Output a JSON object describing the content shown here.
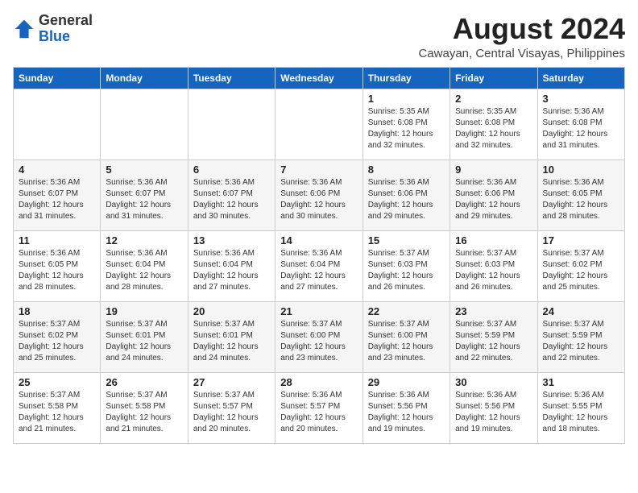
{
  "header": {
    "logo_general": "General",
    "logo_blue": "Blue",
    "month_year": "August 2024",
    "location": "Cawayan, Central Visayas, Philippines"
  },
  "days_of_week": [
    "Sunday",
    "Monday",
    "Tuesday",
    "Wednesday",
    "Thursday",
    "Friday",
    "Saturday"
  ],
  "weeks": [
    [
      {
        "day": "",
        "info": ""
      },
      {
        "day": "",
        "info": ""
      },
      {
        "day": "",
        "info": ""
      },
      {
        "day": "",
        "info": ""
      },
      {
        "day": "1",
        "info": "Sunrise: 5:35 AM\nSunset: 6:08 PM\nDaylight: 12 hours\nand 32 minutes."
      },
      {
        "day": "2",
        "info": "Sunrise: 5:35 AM\nSunset: 6:08 PM\nDaylight: 12 hours\nand 32 minutes."
      },
      {
        "day": "3",
        "info": "Sunrise: 5:36 AM\nSunset: 6:08 PM\nDaylight: 12 hours\nand 31 minutes."
      }
    ],
    [
      {
        "day": "4",
        "info": "Sunrise: 5:36 AM\nSunset: 6:07 PM\nDaylight: 12 hours\nand 31 minutes."
      },
      {
        "day": "5",
        "info": "Sunrise: 5:36 AM\nSunset: 6:07 PM\nDaylight: 12 hours\nand 31 minutes."
      },
      {
        "day": "6",
        "info": "Sunrise: 5:36 AM\nSunset: 6:07 PM\nDaylight: 12 hours\nand 30 minutes."
      },
      {
        "day": "7",
        "info": "Sunrise: 5:36 AM\nSunset: 6:06 PM\nDaylight: 12 hours\nand 30 minutes."
      },
      {
        "day": "8",
        "info": "Sunrise: 5:36 AM\nSunset: 6:06 PM\nDaylight: 12 hours\nand 29 minutes."
      },
      {
        "day": "9",
        "info": "Sunrise: 5:36 AM\nSunset: 6:06 PM\nDaylight: 12 hours\nand 29 minutes."
      },
      {
        "day": "10",
        "info": "Sunrise: 5:36 AM\nSunset: 6:05 PM\nDaylight: 12 hours\nand 28 minutes."
      }
    ],
    [
      {
        "day": "11",
        "info": "Sunrise: 5:36 AM\nSunset: 6:05 PM\nDaylight: 12 hours\nand 28 minutes."
      },
      {
        "day": "12",
        "info": "Sunrise: 5:36 AM\nSunset: 6:04 PM\nDaylight: 12 hours\nand 28 minutes."
      },
      {
        "day": "13",
        "info": "Sunrise: 5:36 AM\nSunset: 6:04 PM\nDaylight: 12 hours\nand 27 minutes."
      },
      {
        "day": "14",
        "info": "Sunrise: 5:36 AM\nSunset: 6:04 PM\nDaylight: 12 hours\nand 27 minutes."
      },
      {
        "day": "15",
        "info": "Sunrise: 5:37 AM\nSunset: 6:03 PM\nDaylight: 12 hours\nand 26 minutes."
      },
      {
        "day": "16",
        "info": "Sunrise: 5:37 AM\nSunset: 6:03 PM\nDaylight: 12 hours\nand 26 minutes."
      },
      {
        "day": "17",
        "info": "Sunrise: 5:37 AM\nSunset: 6:02 PM\nDaylight: 12 hours\nand 25 minutes."
      }
    ],
    [
      {
        "day": "18",
        "info": "Sunrise: 5:37 AM\nSunset: 6:02 PM\nDaylight: 12 hours\nand 25 minutes."
      },
      {
        "day": "19",
        "info": "Sunrise: 5:37 AM\nSunset: 6:01 PM\nDaylight: 12 hours\nand 24 minutes."
      },
      {
        "day": "20",
        "info": "Sunrise: 5:37 AM\nSunset: 6:01 PM\nDaylight: 12 hours\nand 24 minutes."
      },
      {
        "day": "21",
        "info": "Sunrise: 5:37 AM\nSunset: 6:00 PM\nDaylight: 12 hours\nand 23 minutes."
      },
      {
        "day": "22",
        "info": "Sunrise: 5:37 AM\nSunset: 6:00 PM\nDaylight: 12 hours\nand 23 minutes."
      },
      {
        "day": "23",
        "info": "Sunrise: 5:37 AM\nSunset: 5:59 PM\nDaylight: 12 hours\nand 22 minutes."
      },
      {
        "day": "24",
        "info": "Sunrise: 5:37 AM\nSunset: 5:59 PM\nDaylight: 12 hours\nand 22 minutes."
      }
    ],
    [
      {
        "day": "25",
        "info": "Sunrise: 5:37 AM\nSunset: 5:58 PM\nDaylight: 12 hours\nand 21 minutes."
      },
      {
        "day": "26",
        "info": "Sunrise: 5:37 AM\nSunset: 5:58 PM\nDaylight: 12 hours\nand 21 minutes."
      },
      {
        "day": "27",
        "info": "Sunrise: 5:37 AM\nSunset: 5:57 PM\nDaylight: 12 hours\nand 20 minutes."
      },
      {
        "day": "28",
        "info": "Sunrise: 5:36 AM\nSunset: 5:57 PM\nDaylight: 12 hours\nand 20 minutes."
      },
      {
        "day": "29",
        "info": "Sunrise: 5:36 AM\nSunset: 5:56 PM\nDaylight: 12 hours\nand 19 minutes."
      },
      {
        "day": "30",
        "info": "Sunrise: 5:36 AM\nSunset: 5:56 PM\nDaylight: 12 hours\nand 19 minutes."
      },
      {
        "day": "31",
        "info": "Sunrise: 5:36 AM\nSunset: 5:55 PM\nDaylight: 12 hours\nand 18 minutes."
      }
    ]
  ]
}
